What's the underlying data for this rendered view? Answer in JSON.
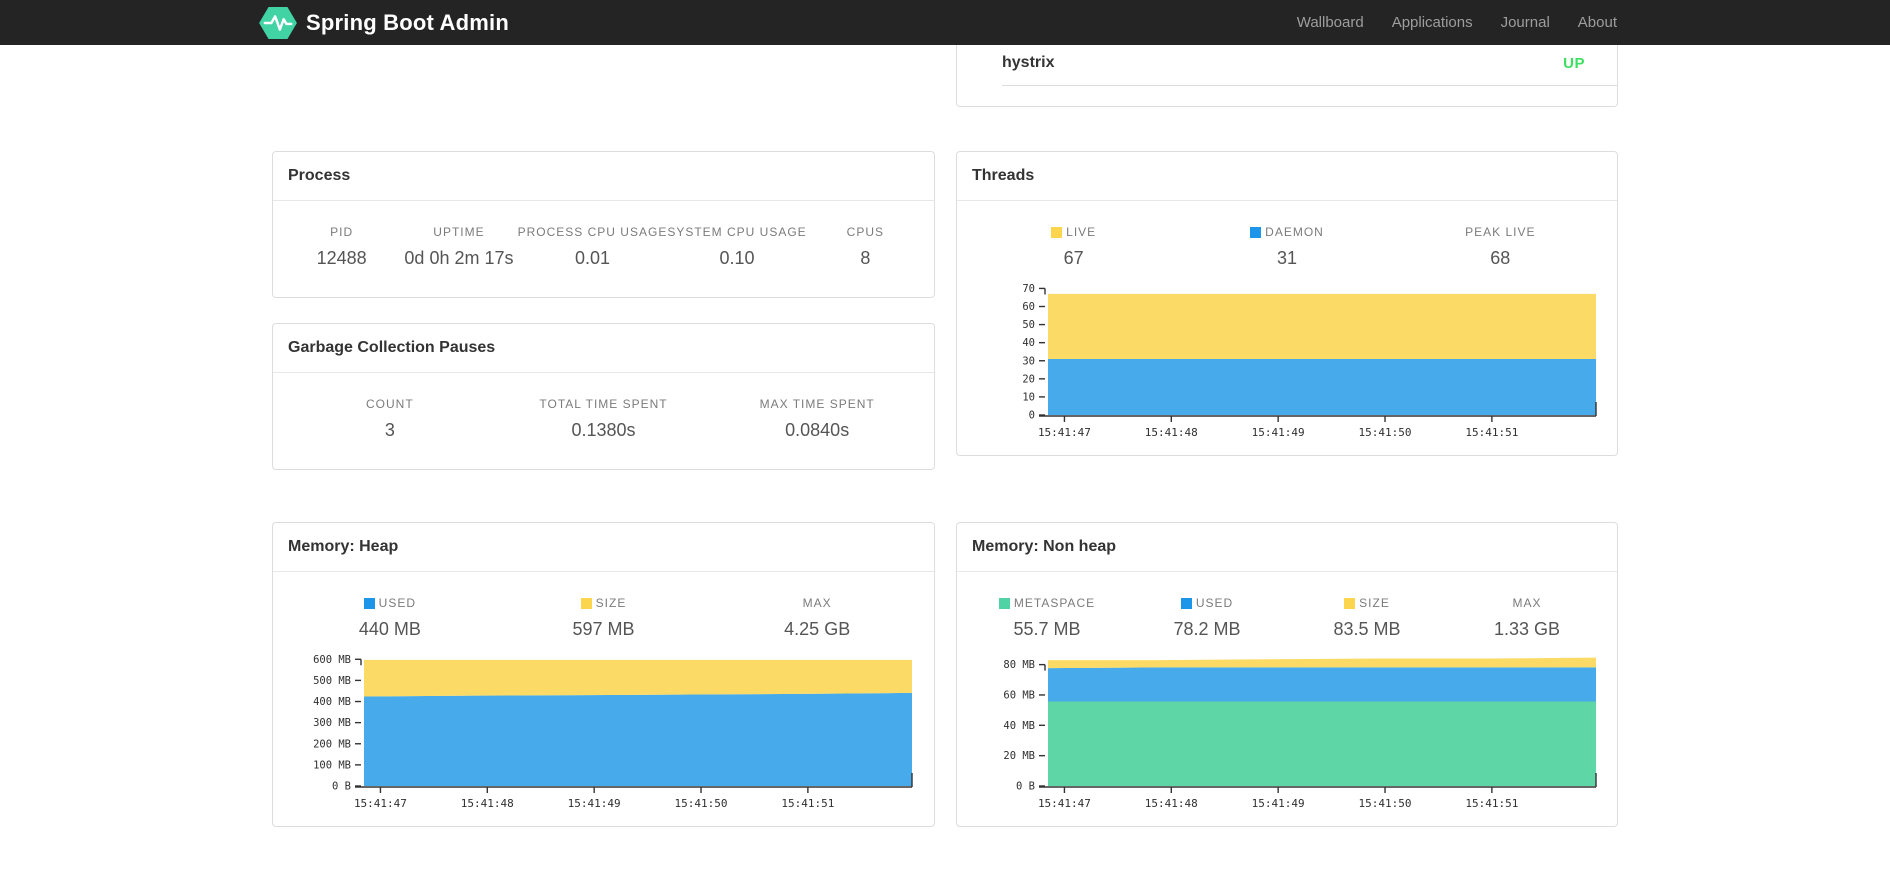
{
  "navbar": {
    "brand": "Spring Boot Admin",
    "links": [
      {
        "label": "Wallboard"
      },
      {
        "label": "Applications"
      },
      {
        "label": "Journal"
      },
      {
        "label": "About"
      }
    ]
  },
  "colors": {
    "accent_green": "#42d3a5",
    "status_up": "#3ce061",
    "area_blue": "#47abeb",
    "area_yellow": "#fbdb65",
    "area_green": "#5fd6a6",
    "legend_blue": "#1d96e9",
    "legend_yellow": "#fcd54e",
    "legend_green": "#4fd3a4"
  },
  "health": {
    "name": "hystrix",
    "status": "UP"
  },
  "panels": {
    "process": {
      "title": "Process",
      "stats": [
        {
          "label": "PID",
          "value": "12488"
        },
        {
          "label": "UPTIME",
          "value": "0d 0h 2m 17s"
        },
        {
          "label": "PROCESS CPU USAGE",
          "value": "0.01"
        },
        {
          "label": "SYSTEM CPU USAGE",
          "value": "0.10"
        },
        {
          "label": "CPUS",
          "value": "8"
        }
      ]
    },
    "gc": {
      "title": "Garbage Collection Pauses",
      "stats": [
        {
          "label": "COUNT",
          "value": "3"
        },
        {
          "label": "TOTAL TIME SPENT",
          "value": "0.1380s"
        },
        {
          "label": "MAX TIME SPENT",
          "value": "0.0840s"
        }
      ]
    },
    "threads": {
      "title": "Threads",
      "stats": [
        {
          "label": "LIVE",
          "value": "67",
          "swatch": "#fcd54e"
        },
        {
          "label": "DAEMON",
          "value": "31",
          "swatch": "#1d96e9"
        },
        {
          "label": "PEAK LIVE",
          "value": "68"
        }
      ]
    },
    "heap": {
      "title": "Memory: Heap",
      "stats": [
        {
          "label": "USED",
          "value": "440 MB",
          "swatch": "#1d96e9"
        },
        {
          "label": "SIZE",
          "value": "597 MB",
          "swatch": "#fcd54e"
        },
        {
          "label": "MAX",
          "value": "4.25 GB"
        }
      ]
    },
    "nonheap": {
      "title": "Memory: Non heap",
      "stats": [
        {
          "label": "METASPACE",
          "value": "55.7 MB",
          "swatch": "#4fd3a4"
        },
        {
          "label": "USED",
          "value": "78.2 MB",
          "swatch": "#1d96e9"
        },
        {
          "label": "SIZE",
          "value": "83.5 MB",
          "swatch": "#fcd54e"
        },
        {
          "label": "MAX",
          "value": "1.33 GB"
        }
      ]
    }
  },
  "chart_data": [
    {
      "id": "threads",
      "type": "area",
      "stacked": true,
      "title": "Threads",
      "x_labels": [
        "15:41:47",
        "15:41:48",
        "15:41:49",
        "15:41:50",
        "15:41:51"
      ],
      "x_label_fracs": [
        0.03,
        0.225,
        0.42,
        0.615,
        0.81
      ],
      "y_ticks": [
        {
          "v": 0,
          "label": "0"
        },
        {
          "v": 10,
          "label": "10"
        },
        {
          "v": 20,
          "label": "20"
        },
        {
          "v": 30,
          "label": "30"
        },
        {
          "v": 40,
          "label": "40"
        },
        {
          "v": 50,
          "label": "50"
        },
        {
          "v": 60,
          "label": "60"
        },
        {
          "v": 70,
          "label": "70"
        }
      ],
      "ylim": [
        0,
        73
      ],
      "series": [
        {
          "name": "DAEMON",
          "color": "#47abeb",
          "values": [
            31,
            31,
            31,
            31,
            31,
            31
          ]
        },
        {
          "name": "LIVE",
          "color": "#fbdb65",
          "values": [
            67,
            67,
            67,
            67,
            67,
            67
          ]
        }
      ]
    },
    {
      "id": "heap",
      "type": "area",
      "stacked": true,
      "title": "Memory: Heap",
      "x_labels": [
        "15:41:47",
        "15:41:48",
        "15:41:49",
        "15:41:50",
        "15:41:51"
      ],
      "x_label_fracs": [
        0.03,
        0.225,
        0.42,
        0.615,
        0.81
      ],
      "y_ticks": [
        {
          "v": 0,
          "label": "0 B"
        },
        {
          "v": 100,
          "label": "100 MB"
        },
        {
          "v": 200,
          "label": "200 MB"
        },
        {
          "v": 300,
          "label": "300 MB"
        },
        {
          "v": 400,
          "label": "400 MB"
        },
        {
          "v": 500,
          "label": "500 MB"
        },
        {
          "v": 600,
          "label": "600 MB"
        }
      ],
      "ylim": [
        0,
        625
      ],
      "series": [
        {
          "name": "USED",
          "color": "#47abeb",
          "values": [
            424,
            428,
            430,
            433,
            436,
            441
          ]
        },
        {
          "name": "SIZE",
          "color": "#fbdb65",
          "values": [
            597,
            597,
            597,
            597,
            597,
            597
          ]
        }
      ]
    },
    {
      "id": "nonheap",
      "type": "area",
      "stacked": true,
      "title": "Memory: Non heap",
      "x_labels": [
        "15:41:47",
        "15:41:48",
        "15:41:49",
        "15:41:50",
        "15:41:51"
      ],
      "x_label_fracs": [
        0.03,
        0.225,
        0.42,
        0.615,
        0.81
      ],
      "y_ticks": [
        {
          "v": 0,
          "label": "0 B"
        },
        {
          "v": 20,
          "label": "20 MB"
        },
        {
          "v": 40,
          "label": "40 MB"
        },
        {
          "v": 60,
          "label": "60 MB"
        },
        {
          "v": 80,
          "label": "80 MB"
        }
      ],
      "ylim": [
        0,
        87
      ],
      "series": [
        {
          "name": "METASPACE",
          "color": "#5fd6a6",
          "values": [
            55.7,
            55.7,
            55.7,
            55.7,
            55.7,
            55.7
          ]
        },
        {
          "name": "USED",
          "color": "#47abeb",
          "values": [
            77.7,
            78.2,
            78.2,
            78.2,
            78.2,
            78.2
          ]
        },
        {
          "name": "SIZE",
          "color": "#fbdb65",
          "values": [
            83,
            83,
            83.5,
            84,
            84,
            84.6
          ]
        }
      ]
    }
  ]
}
